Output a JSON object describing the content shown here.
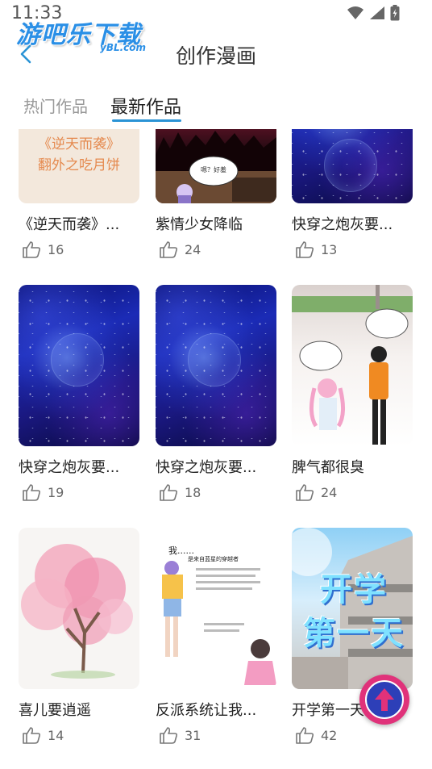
{
  "status_bar": {
    "time": "11:33"
  },
  "watermark": {
    "main": "游吧乐下载",
    "sub": "yBL.com"
  },
  "header": {
    "title": "创作漫画"
  },
  "tabs": [
    {
      "label": "热门作品",
      "active": false
    },
    {
      "label": "最新作品",
      "active": true
    }
  ],
  "colors": {
    "accent": "#2a93d5",
    "watermark": "#2a8fe6",
    "tab_inactive": "#999999",
    "fab_ring": "#e0327a",
    "fab_inner": "#2d3fb8"
  },
  "cards": [
    {
      "title": "《逆天而袭》...",
      "likes": "16",
      "cover_text_1": "《逆天而袭》",
      "cover_text_2": "翻外之吃月饼"
    },
    {
      "title": "紫情少女降临",
      "likes": "24",
      "cover_text_1": "嗯？好羞",
      "cover_text_2": ""
    },
    {
      "title": "快穿之炮灰要...",
      "likes": "13"
    },
    {
      "title": "快穿之炮灰要...",
      "likes": "19"
    },
    {
      "title": "快穿之炮灰要...",
      "likes": "18"
    },
    {
      "title": "脾气都很臭",
      "likes": "24"
    },
    {
      "title": "喜儿要逍遥",
      "likes": "14"
    },
    {
      "title": "反派系统让我...",
      "likes": "31",
      "cover_text_1": "我......",
      "cover_text_2": "是来自蓝星的穿越者"
    },
    {
      "title": "开学第一天",
      "likes": "42",
      "cover_text_1": "开学",
      "cover_text_2": "第一天"
    }
  ],
  "icons": {
    "back": "chevron-left-icon",
    "like": "thumbs-up-icon",
    "scroll_top": "arrow-up-icon",
    "wifi": "wifi-icon",
    "signal": "signal-icon",
    "battery": "battery-icon"
  }
}
